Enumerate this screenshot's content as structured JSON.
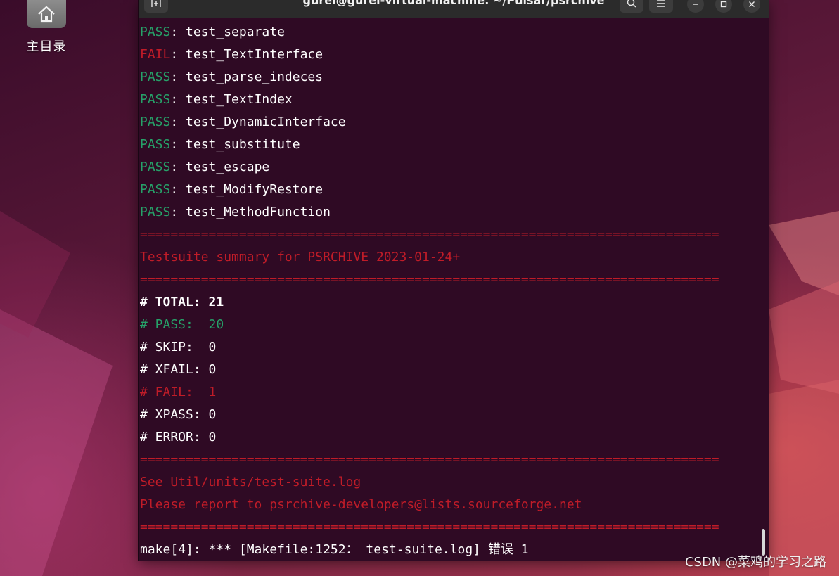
{
  "desktop": {
    "home_icon": "home-icon",
    "home_label": "主目录"
  },
  "window": {
    "title": "gurei@gurei-virtual-machine: ~/Pulsar/psrchive",
    "new_tab_icon": "new-tab-icon",
    "search_icon": "search-icon",
    "menu_icon": "hamburger-menu-icon",
    "minimize_icon": "minimize-icon",
    "maximize_icon": "maximize-icon",
    "close_icon": "close-icon"
  },
  "terminal": {
    "results": [
      {
        "status": "PASS",
        "name": ": test_separate"
      },
      {
        "status": "FAIL",
        "name": ": test_TextInterface"
      },
      {
        "status": "PASS",
        "name": ": test_parse_indeces"
      },
      {
        "status": "PASS",
        "name": ": test_TextIndex"
      },
      {
        "status": "PASS",
        "name": ": test_DynamicInterface"
      },
      {
        "status": "PASS",
        "name": ": test_substitute"
      },
      {
        "status": "PASS",
        "name": ": test_escape"
      },
      {
        "status": "PASS",
        "name": ": test_ModifyRestore"
      },
      {
        "status": "PASS",
        "name": ": test_MethodFunction"
      }
    ],
    "separator": "============================================================================",
    "summary_title": "Testsuite summary for PSRCHIVE 2023-01-24+",
    "total": "# TOTAL: 21",
    "pass": "# PASS:  20",
    "skip": "# SKIP:  0",
    "xfail": "# XFAIL: 0",
    "fail": "# FAIL:  1",
    "xpass": "# XPASS: 0",
    "error": "# ERROR: 0",
    "see_log": "See Util/units/test-suite.log",
    "report": "Please report to psrchive-developers@lists.sourceforge.net",
    "make_error": "make[4]: *** [Makefile:1252： test-suite.log] 错误 1"
  },
  "watermark": "CSDN @菜鸡的学习之路",
  "colors": {
    "terminal_bg": "#2f0a24",
    "pass_green": "#26a269",
    "fail_red": "#c01c28",
    "text": "#ffffff"
  }
}
